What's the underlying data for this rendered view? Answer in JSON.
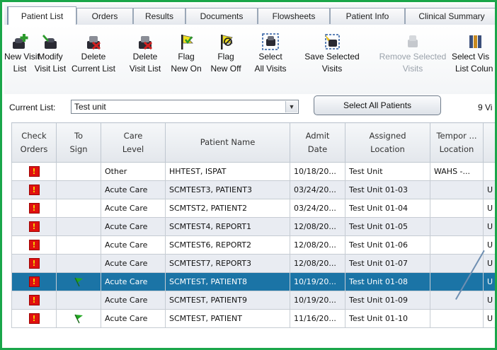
{
  "tabs": [
    "Patient List",
    "Orders",
    "Results",
    "Documents",
    "Flowsheets",
    "Patient Info",
    "Clinical Summary"
  ],
  "toolbar": [
    {
      "line1": "New Visit",
      "line2": "List",
      "icon": "new-list-icon",
      "enabled": true
    },
    {
      "line1": "Modify",
      "line2": "Visit List",
      "icon": "modify-list-icon",
      "enabled": true
    },
    {
      "line1": "Delete",
      "line2": "Current List",
      "icon": "delete-current-list-icon",
      "enabled": true
    },
    {
      "line1": "Delete",
      "line2": "Visit List",
      "icon": "delete-visit-list-icon",
      "enabled": true
    },
    {
      "line1": "Flag",
      "line2": "New On",
      "icon": "flag-on-icon",
      "enabled": true
    },
    {
      "line1": "Flag",
      "line2": "New Off",
      "icon": "flag-off-icon",
      "enabled": true
    },
    {
      "line1": "Select",
      "line2": "All Visits",
      "icon": "select-all-icon",
      "enabled": true
    },
    {
      "line1": "Save Selected",
      "line2": "Visits",
      "icon": "save-selected-icon",
      "enabled": true
    },
    {
      "line1": "Remove Selected",
      "line2": "Visits",
      "icon": "remove-selected-icon",
      "enabled": false
    },
    {
      "line1": "Select Vis",
      "line2": "List Colun",
      "icon": "list-columns-icon",
      "enabled": true
    }
  ],
  "current_list": {
    "label": "Current List:",
    "value": "Test unit"
  },
  "select_all_label": "Select All Patients",
  "visits_count": "9 Vi",
  "columns": [
    {
      "l1": "Check",
      "l2": "Orders"
    },
    {
      "l1": "To",
      "l2": "Sign"
    },
    {
      "l1": "Care",
      "l2": "Level"
    },
    {
      "l1": "Patient Name",
      "l2": ""
    },
    {
      "l1": "Admit",
      "l2": "Date"
    },
    {
      "l1": "Assigned",
      "l2": "Location"
    },
    {
      "l1": "Tempor ...",
      "l2": "Location"
    },
    {
      "l1": "",
      "l2": ""
    }
  ],
  "rows": [
    {
      "check": true,
      "sign": false,
      "care": "Other",
      "name": "HHTEST, ISPAT",
      "admit": "10/18/20...",
      "loc": "Test Unit",
      "temp": "WAHS -...",
      "extra": "",
      "selected": false
    },
    {
      "check": true,
      "sign": false,
      "care": "Acute Care",
      "name": "SCMTEST3, PATIENT3",
      "admit": "03/24/20...",
      "loc": "Test Unit 01-03",
      "temp": "",
      "extra": "U",
      "selected": false
    },
    {
      "check": true,
      "sign": false,
      "care": "Acute Care",
      "name": "SCMTST2, PATIENT2",
      "admit": "03/24/20...",
      "loc": "Test Unit 01-04",
      "temp": "",
      "extra": "U",
      "selected": false
    },
    {
      "check": true,
      "sign": false,
      "care": "Acute Care",
      "name": "SCMTEST4, REPORT1",
      "admit": "12/08/20...",
      "loc": "Test Unit 01-05",
      "temp": "",
      "extra": "U",
      "selected": false
    },
    {
      "check": true,
      "sign": false,
      "care": "Acute Care",
      "name": "SCMTEST6, REPORT2",
      "admit": "12/08/20...",
      "loc": "Test Unit 01-06",
      "temp": "",
      "extra": "U",
      "selected": false
    },
    {
      "check": true,
      "sign": false,
      "care": "Acute Care",
      "name": "SCMTEST7, REPORT3",
      "admit": "12/08/20...",
      "loc": "Test Unit 01-07",
      "temp": "",
      "extra": "U",
      "selected": false
    },
    {
      "check": true,
      "sign": true,
      "care": "Acute Care",
      "name": "SCMTEST, PATIENT8",
      "admit": "10/19/20...",
      "loc": "Test Unit 01-08",
      "temp": "",
      "extra": "U",
      "selected": true
    },
    {
      "check": true,
      "sign": false,
      "care": "Acute Care",
      "name": "SCMTEST, PATIENT9",
      "admit": "10/19/20...",
      "loc": "Test Unit 01-09",
      "temp": "",
      "extra": "U",
      "selected": false
    },
    {
      "check": true,
      "sign": true,
      "care": "Acute Care",
      "name": "SCMTEST, PATIENT",
      "admit": "11/16/20...",
      "loc": "Test Unit 01-10",
      "temp": "",
      "extra": "U",
      "selected": false
    }
  ],
  "colors": {
    "frame": "#1aa64a",
    "selected_row": "#1b74a6",
    "alt_row": "#e9ecf2",
    "alert": "#e01010",
    "flag": "#22a822"
  }
}
